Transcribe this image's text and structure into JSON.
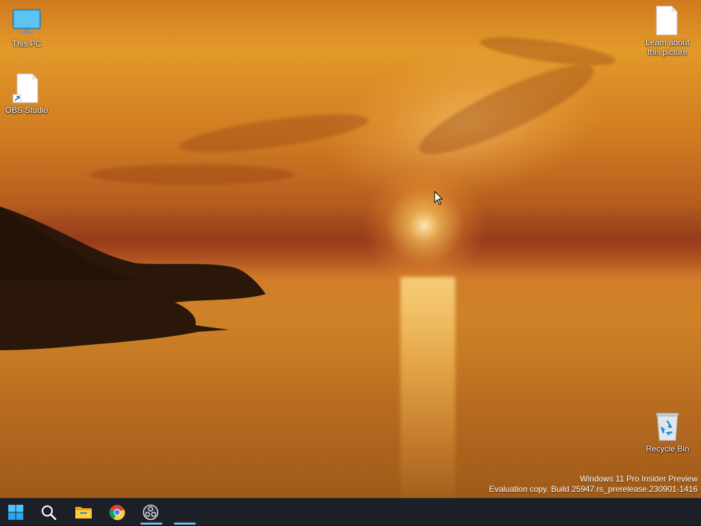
{
  "desktop": {
    "icons": [
      {
        "label": "This PC",
        "icon": "monitor-icon"
      },
      {
        "label": "OBS Studio",
        "icon": "shortcut-file-icon"
      },
      {
        "label": "Learn about this picture",
        "icon": "file-icon"
      },
      {
        "label": "Recycle Bin",
        "icon": "recycle-bin-icon"
      }
    ],
    "watermark": {
      "line1": "Windows 11 Pro Insider Preview",
      "line2": "Evaluation copy. Build 25947.rs_prerelease.230901-1416"
    }
  },
  "taskbar": {
    "items": [
      {
        "name": "Start",
        "icon": "windows-start-icon"
      },
      {
        "name": "Search",
        "icon": "search-icon"
      },
      {
        "name": "File Explorer",
        "icon": "folder-icon"
      },
      {
        "name": "Google Chrome",
        "icon": "chrome-icon"
      },
      {
        "name": "OBS Studio",
        "icon": "obs-icon"
      }
    ]
  },
  "colors": {
    "taskbar_bg": "#1c2026",
    "accent": "#76b9ed"
  }
}
